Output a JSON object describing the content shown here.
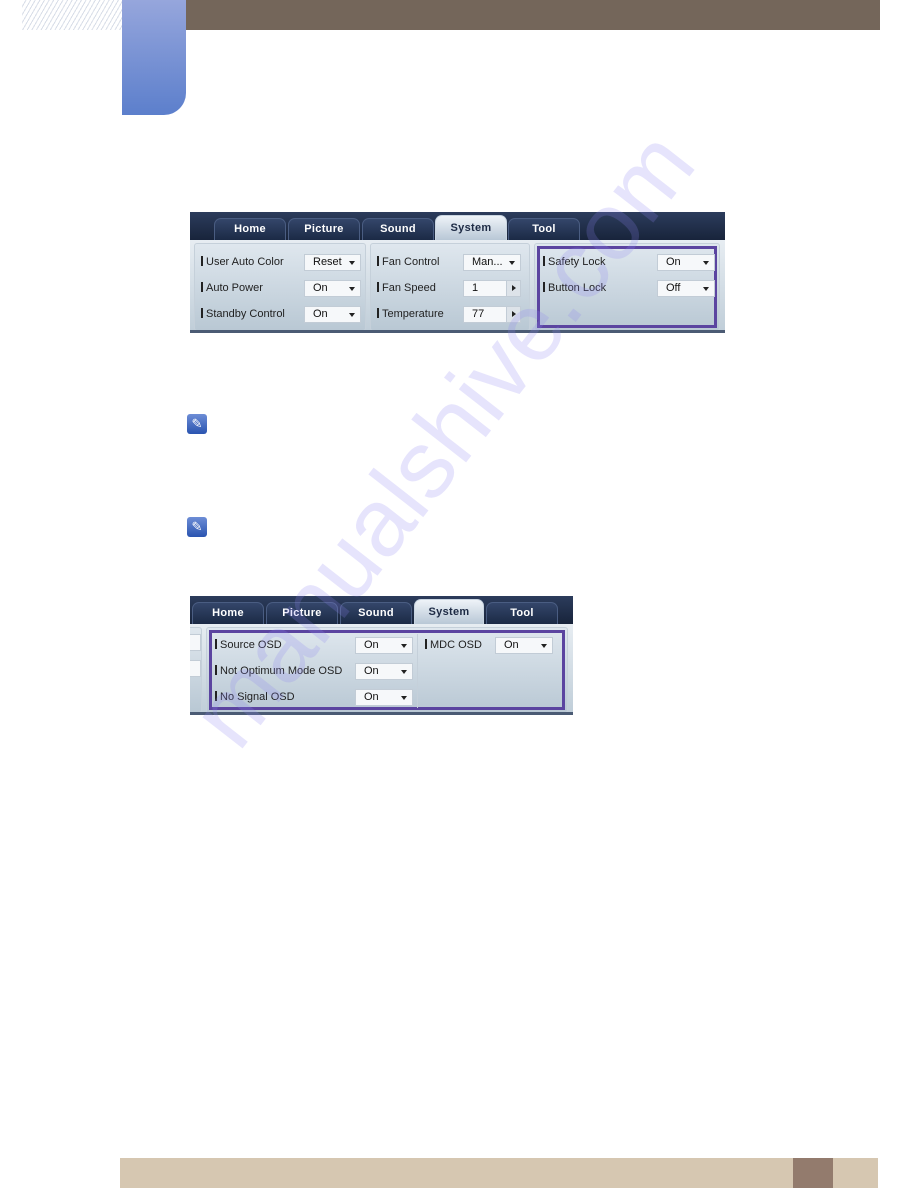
{
  "document": {
    "colors": {
      "header_bar": "#74665a",
      "chapter_tab": "#5c7fcc",
      "footer_bar": "#d6c7b1",
      "footer_page_block": "#937b6d",
      "highlight_box": "#5b44a0"
    },
    "watermark": "manualshive.com",
    "notes": [
      {
        "icon": "note-pencil-icon"
      },
      {
        "icon": "note-pencil-icon"
      }
    ]
  },
  "screenshot1": {
    "tabs": [
      {
        "label": "Home",
        "active": false
      },
      {
        "label": "Picture",
        "active": false
      },
      {
        "label": "Sound",
        "active": false
      },
      {
        "label": "System",
        "active": true
      },
      {
        "label": "Tool",
        "active": false
      }
    ],
    "groups": [
      {
        "rows": [
          {
            "label": "User Auto Color",
            "value": "Reset",
            "control": "dropdown"
          },
          {
            "label": "Auto Power",
            "value": "On",
            "control": "dropdown"
          },
          {
            "label": "Standby Control",
            "value": "On",
            "control": "dropdown"
          }
        ]
      },
      {
        "rows": [
          {
            "label": "Fan Control",
            "value": "Man...",
            "control": "dropdown"
          },
          {
            "label": "Fan Speed",
            "value": "1",
            "control": "spinner"
          },
          {
            "label": "Temperature",
            "value": "77",
            "control": "spinner"
          }
        ]
      },
      {
        "highlighted": true,
        "rows": [
          {
            "label": "Safety Lock",
            "value": "On",
            "control": "dropdown"
          },
          {
            "label": "Button Lock",
            "value": "Off",
            "control": "dropdown"
          }
        ]
      }
    ]
  },
  "screenshot2": {
    "tabs": [
      {
        "label": "Home",
        "active": false
      },
      {
        "label": "Picture",
        "active": false
      },
      {
        "label": "Sound",
        "active": false
      },
      {
        "label": "System",
        "active": true
      },
      {
        "label": "Tool",
        "active": false
      }
    ],
    "groups": [
      {
        "highlighted": true,
        "rows": [
          {
            "label": "Source OSD",
            "value": "On",
            "control": "dropdown"
          },
          {
            "label": "Not Optimum Mode OSD",
            "value": "On",
            "control": "dropdown"
          },
          {
            "label": "No Signal OSD",
            "value": "On",
            "control": "dropdown"
          },
          {
            "label": "MDC OSD",
            "value": "On",
            "control": "dropdown"
          }
        ]
      }
    ]
  }
}
